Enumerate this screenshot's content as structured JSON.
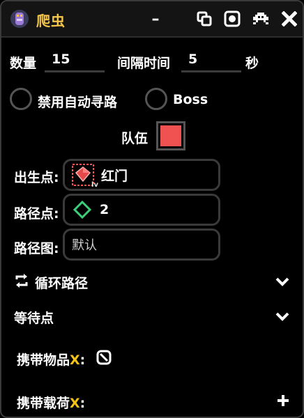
{
  "window": {
    "title": "爬虫",
    "minimize_glyph": "–",
    "icons": [
      "copy-icon",
      "record-icon",
      "invader-icon",
      "close-icon"
    ]
  },
  "quantity": {
    "label": "数量",
    "value": "15"
  },
  "interval": {
    "label": "间隔时间",
    "value": "5",
    "unit": "秒"
  },
  "checkboxes": {
    "disable_pathfinding": "禁用自动寻路",
    "boss": "Boss"
  },
  "team": {
    "label": "队伍",
    "color": "#f05252"
  },
  "spawn": {
    "label": "出生点:",
    "value": "红门",
    "icon_badge": "lv"
  },
  "waypoint": {
    "label": "路径点:",
    "value": "2"
  },
  "pathmap": {
    "label": "路径图:",
    "placeholder": "默认"
  },
  "loop_path": {
    "label": "循环路径"
  },
  "wait_point": {
    "label": "等待点"
  },
  "carry_items": {
    "label": "携带物品",
    "x_mark": "X",
    "colon": ":"
  },
  "carry_payload": {
    "label": "携带载荷",
    "x_mark": "X",
    "colon": ":"
  },
  "colors": {
    "accent": "#f6c64b",
    "x_mark": "#f3c416",
    "waypoint": "#3ccf7a",
    "team": "#f05252"
  }
}
